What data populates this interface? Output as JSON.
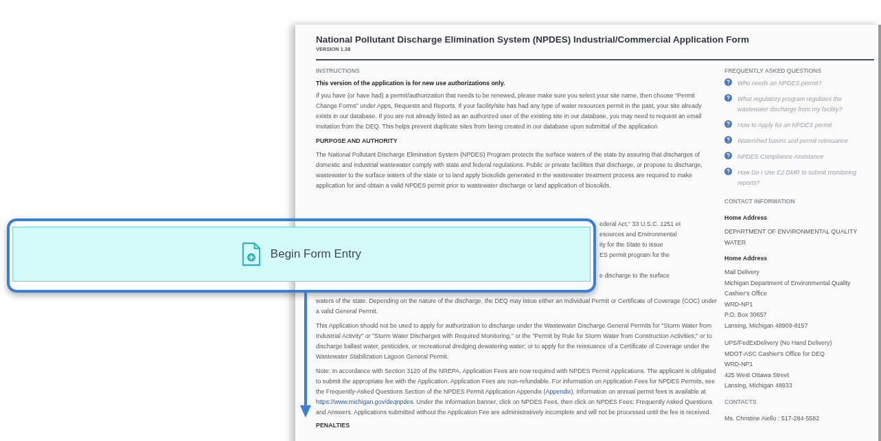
{
  "form": {
    "title": "National Pollutant Discharge Elimination System (NPDES) Industrial/Commercial Application Form",
    "version": "VERSION 1.38"
  },
  "instructions": {
    "heading": "INSTRUCTIONS",
    "notice": "This version of the application is for new use authorizations only.",
    "text": "If you have (or have had) a permit/authorization that needs to be renewed, please make sure you select your site name, then choose \"Permit Change Forms\" under Apps, Requests and Reports. If your facility/site has had any type of water resources permit in the past, your site already exists in our database. If you are not already listed as an authorized user of the existing site in our database, you may need to request an email invitation from the DEQ. This helps prevent duplicate sites from being created in our database upon submittal of the application"
  },
  "purpose": {
    "heading": "PURPOSE AND AUTHORITY",
    "text": "The National Pollutant Discharge Elimination System (NPDES) Program protects the surface waters of the state by assuring that discharges of domestic and industrial wastewater comply with state and federal regulations.  Public or private facilities that discharge, or propose to discharge, wastewater to the surface waters of the state or to land apply biosolids generated in the wastewater treatment process are required to make application for and obtain a valid NPDES permit prior to wastewater discharge or land application of  biosolids.",
    "covered_lines": [
      "ederal Act,\" 33 U.S.C. 1251 et",
      "esources and Environmental",
      "ity for the State to issue",
      "ES permit program for the",
      "e discharge to the surface"
    ],
    "after_cover": "waters of the state.  Depending on the nature of the discharge, the DEQ may issue either an Individual Permit or Certificate of Coverage (COC) under a valid General Permit.",
    "exclusions": "This Application should not be used to apply for authorization to discharge under the Wastewater Discharge General Permits for \"Storm Water from Industrial Activity\" or \"Storm Water Discharges with Required Monitoring,\" or the \"Permit by Rule for Storm Water from Construction Activities;\" or to discharge ballast water, pesticides, or recreational dredging dewatering water; or to apply for the reissuance of a Certificate of Coverage under the Wastewater Stabilization Lagoon General Permit.",
    "note": [
      {
        "kind": "text",
        "text": "Note:  In accordance with Section 3120 of the NREPA, Application Fees are now required with NPDES Permit Applications.  The applicant is obligated to submit the appropriate fee with the Application.  Application Fees are non-refundable.  For information on Application Fees for NPDES Permits, see the Frequently-Asked Questions Section of the NPDES Permit Application Appendix ("
      },
      {
        "kind": "link",
        "text": "Appendix"
      },
      {
        "kind": "text",
        "text": ").  Information on annual permit fees is available at "
      },
      {
        "kind": "link",
        "text": "https://www.michigan.gov/deqnpdes"
      },
      {
        "kind": "text",
        "text": ".  Under the Information banner, click on NPDES Fees, then click on NPDES Fees:  Frequently Asked Questions and Answers.  Applications submitted without the Application Fee are administratively incomplete and will not be processed until the fee is received."
      }
    ]
  },
  "penalties": {
    "heading": "PENALTIES"
  },
  "faq": {
    "heading": "FREQUENTLY ASKED QUESTIONS",
    "items": [
      "Who needs an NPDES permit?",
      "What regulatory program regulates the wastewater discharge from my facility?",
      "How to Apply for an NPDES permit",
      "Watershed basins and permit reissuance",
      "NPDES Compliance Assistance",
      "How Do I Use E2 DMR to submit monitoring reports?"
    ]
  },
  "contact": {
    "heading": "CONTACT INFORMATION",
    "blocks": [
      {
        "label": "Home Address",
        "lines": [
          "DEPARTMENT OF ENVIRONMENTAL QUALITY",
          "WATER"
        ]
      },
      {
        "label": "Home Address",
        "lines": [
          "Mail Delivery",
          "Michigan Department of Environmental Quality",
          "Cashier's Office",
          "WRD-NP1",
          "P.O. Box 30657",
          "Lansing, Michigan 48909-8157"
        ]
      },
      {
        "lines": [
          "UPS/FedExDelivery (No Hand Delivery)",
          "MDOT-ASC Cashier's Office for DEQ",
          "WRD-NP1",
          "425 West Ottawa Street",
          "Lansing, Michigan 48933"
        ]
      }
    ]
  },
  "contacts": {
    "heading": "CONTACTS",
    "items": [
      "Ms. Christine Aiello : 517-284-5582"
    ]
  },
  "callout": {
    "button": "Begin Form Entry"
  }
}
